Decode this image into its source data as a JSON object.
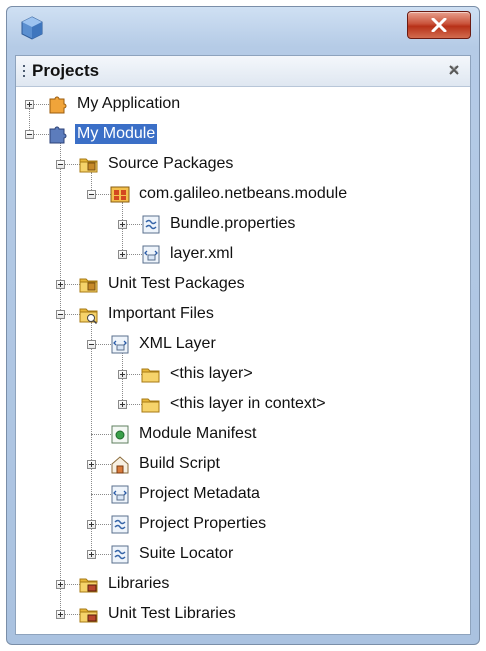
{
  "window": {
    "app_icon": "netbeans-cube-icon",
    "close_icon": "close-x-icon"
  },
  "panel": {
    "title": "Projects",
    "close_icon": "panel-close-icon"
  },
  "tree": [
    {
      "label": "My Application",
      "icon": "suite-puzzle-icon",
      "state": "collapsed"
    },
    {
      "label": "My Module",
      "icon": "module-puzzle-icon",
      "state": "expanded",
      "selected": true
    },
    {
      "label": "Source Packages",
      "icon": "source-packages-folder-icon",
      "state": "expanded"
    },
    {
      "label": "com.galileo.netbeans.module",
      "icon": "package-icon",
      "state": "expanded"
    },
    {
      "label": "Bundle.properties",
      "icon": "properties-file-icon",
      "state": "collapsed"
    },
    {
      "label": "layer.xml",
      "icon": "xml-file-icon",
      "state": "collapsed"
    },
    {
      "label": "Unit Test Packages",
      "icon": "test-packages-folder-icon",
      "state": "collapsed"
    },
    {
      "label": "Important Files",
      "icon": "important-files-folder-icon",
      "state": "expanded"
    },
    {
      "label": "XML Layer",
      "icon": "xml-layer-icon",
      "state": "expanded"
    },
    {
      "label": "<this layer>",
      "icon": "folder-icon",
      "state": "collapsed"
    },
    {
      "label": "<this layer in context>",
      "icon": "folder-icon",
      "state": "collapsed"
    },
    {
      "label": "Module Manifest",
      "icon": "manifest-icon",
      "state": "leaf"
    },
    {
      "label": "Build Script",
      "icon": "build-script-icon",
      "state": "collapsed"
    },
    {
      "label": "Project Metadata",
      "icon": "xml-file-icon",
      "state": "leaf"
    },
    {
      "label": "Project Properties",
      "icon": "properties-file-icon",
      "state": "collapsed"
    },
    {
      "label": "Suite Locator",
      "icon": "properties-file-icon",
      "state": "collapsed"
    },
    {
      "label": "Libraries",
      "icon": "libraries-folder-icon",
      "state": "collapsed"
    },
    {
      "label": "Unit Test Libraries",
      "icon": "libraries-folder-icon",
      "state": "collapsed"
    }
  ],
  "colors": {
    "selection": "#3b6fc7",
    "folder": "#e9b83a",
    "window_frame": "#b5cbe6"
  }
}
